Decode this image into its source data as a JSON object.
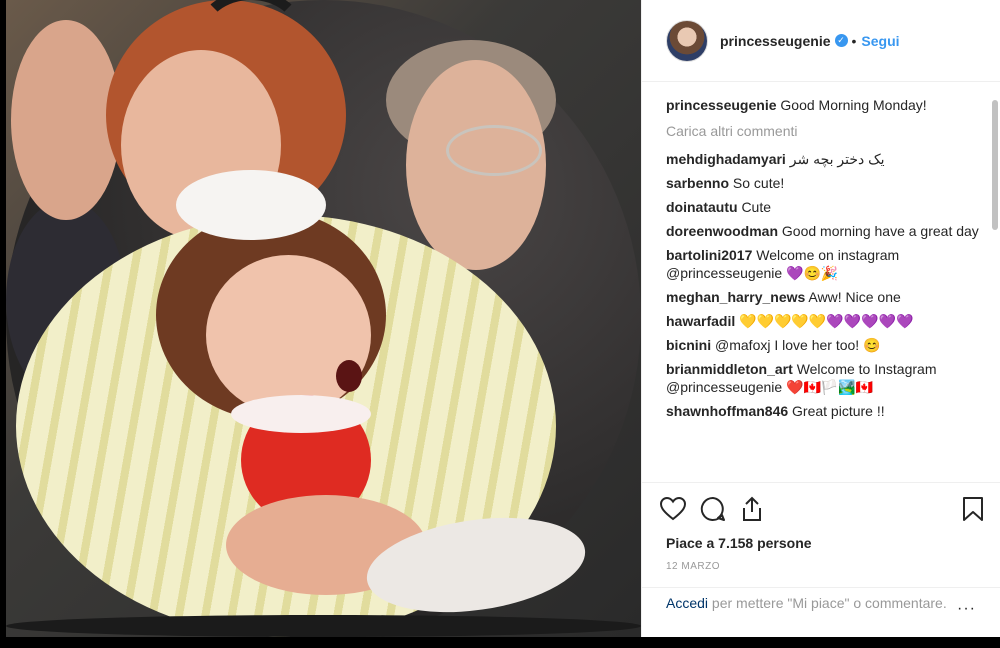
{
  "post": {
    "username": "princesseugenie",
    "verified_icon": "✓",
    "dot": "•",
    "follow_label": "Segui",
    "comments": [
      {
        "user": "princesseugenie",
        "text": "Good Morning Monday!"
      },
      {
        "user": "mehdighadamyari",
        "text": "یک دختر بچه شر"
      },
      {
        "user": "sarbenno",
        "text": "So cute!"
      },
      {
        "user": "doinatautu",
        "text": "Cute"
      },
      {
        "user": "doreenwoodman",
        "text": "Good morning have a great day"
      },
      {
        "user": "bartolini2017",
        "text": "Welcome on instagram @princesseugenie 💜😊🎉"
      },
      {
        "user": "meghan_harry_news",
        "text": "Aww! Nice one"
      },
      {
        "user": "hawarfadil",
        "text": "💛💛💛💛💛💜💜💜💜💜"
      },
      {
        "user": "bicnini",
        "text": "@mafoxj I love her too! 😊"
      },
      {
        "user": "brianmiddleton_art",
        "text": "Welcome to Instagram @princesseugenie ❤️🇨🇦🏳️🏞️🇨🇦"
      },
      {
        "user": "shawnhoffman846",
        "text": "Great picture !!"
      }
    ],
    "load_more": "Carica altri commenti",
    "likes": "Piace a 7.158 persone",
    "date": "12 MARZO",
    "login_link": "Accedi",
    "login_text": " per mettere \"Mi piace\" o commentare.",
    "more_icon": "···"
  },
  "icons": {
    "like": "heart-icon",
    "comment": "comment-icon",
    "share": "share-icon",
    "save": "bookmark-icon",
    "more": "more-options-icon"
  },
  "colors": {
    "link": "#3897f0",
    "text": "#262626",
    "muted": "#999999"
  }
}
